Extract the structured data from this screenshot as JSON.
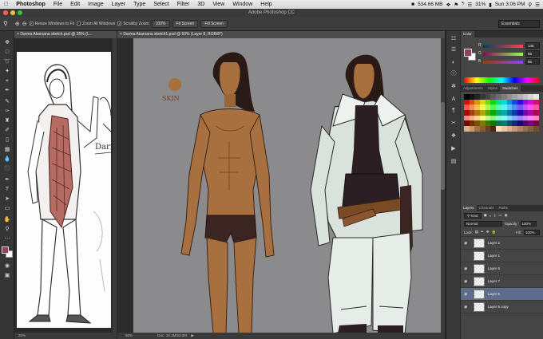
{
  "menubar": {
    "app_name": "Photoshop",
    "items": [
      "File",
      "Edit",
      "Image",
      "Layer",
      "Type",
      "Select",
      "Filter",
      "3D",
      "View",
      "Window",
      "Help"
    ],
    "memory": "534.66 MB",
    "battery": "31%",
    "clock": "Sun 3:06 PM"
  },
  "window": {
    "title": "Adobe Photoshop CC",
    "traffic_colors": [
      "#ff5f57",
      "#febc2e",
      "#28c840"
    ]
  },
  "options": {
    "resize_windows": "Resize Windows to Fit",
    "zoom_all": "Zoom All Windows",
    "scrubby_zoom": "Scrubby Zoom",
    "btn_100": "100%",
    "fit_screen": "Fit Screen",
    "fill_screen": "Fill Screen",
    "workspace": "Essentials"
  },
  "doc1": {
    "tab_label": "Darma Akarsana sketch.psd @ 25% (L...",
    "zoom": "25%",
    "side_text": "Darm"
  },
  "doc2": {
    "tab_label": "Darma Akarsana sketch1.psd @ 50% (Layer 8, RGB/8*)",
    "zoom": "50%",
    "doc_size": "Doc: 18.1M/53.0M",
    "skin_label": "SKIN"
  },
  "color_panel": {
    "tab": "Color",
    "r_label": "R",
    "r_value": "146",
    "g_label": "G",
    "g_value": "65",
    "b_label": "B",
    "b_value": "86",
    "fg_color": "#924156",
    "bg_color": "#ffffff"
  },
  "swatches_panel": {
    "tabs": [
      "Adjustments",
      "Styles",
      "Swatches"
    ],
    "active_tab": "Swatches"
  },
  "layers_panel": {
    "tabs": [
      "Layers",
      "Channels",
      "Paths"
    ],
    "kind": "Kind",
    "blend_mode": "Normal",
    "opacity_label": "Opacity:",
    "opacity_value": "100%",
    "lock_label": "Lock:",
    "fill_label": "Fill:",
    "fill_value": "100%",
    "layers": [
      {
        "name": "Layer 2",
        "visible": true,
        "selected": false
      },
      {
        "name": "Layer 1",
        "visible": false,
        "selected": false
      },
      {
        "name": "Layer 6",
        "visible": true,
        "selected": false
      },
      {
        "name": "Layer 7",
        "visible": true,
        "selected": false
      },
      {
        "name": "Layer 8",
        "visible": true,
        "selected": true
      },
      {
        "name": "Layer 5 copy",
        "visible": true,
        "selected": false
      }
    ]
  },
  "colors": {
    "skin": "#a8703f",
    "skin_dark": "#6b3f22",
    "shorts": "#3b2522",
    "hair": "#2a1a16",
    "shirt": "#d9e3dc",
    "vest": "#2b1f24",
    "belt": "#7a4a25",
    "selection": "#5b6d8a"
  }
}
